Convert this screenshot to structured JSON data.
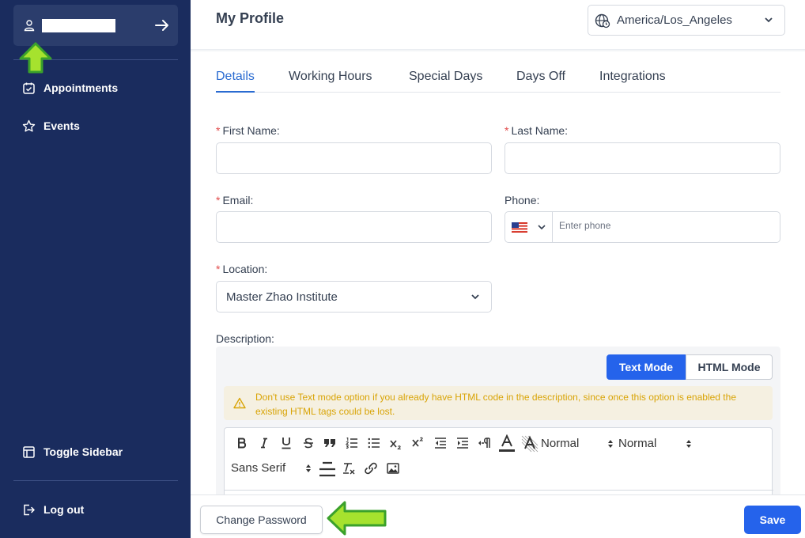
{
  "sidebar": {
    "items": [
      {
        "label": "Appointments",
        "icon": "calendar-check-icon"
      },
      {
        "label": "Events",
        "icon": "star-icon"
      }
    ],
    "toggle_label": "Toggle Sidebar",
    "logout_label": "Log out",
    "colors": {
      "background": "#1a2c5e",
      "card": "#2b3d6c"
    }
  },
  "header": {
    "title": "My Profile",
    "timezone": "America/Los_Angeles"
  },
  "tabs": [
    {
      "label": "Details",
      "active": true
    },
    {
      "label": "Working Hours",
      "active": false
    },
    {
      "label": "Special Days",
      "active": false
    },
    {
      "label": "Days Off",
      "active": false
    },
    {
      "label": "Integrations",
      "active": false
    }
  ],
  "form": {
    "first_name_label": "First Name:",
    "last_name_label": "Last Name:",
    "email_label": "Email:",
    "phone_label": "Phone:",
    "phone_placeholder": "Enter phone",
    "location_label": "Location:",
    "location_value": "Master Zhao Institute",
    "description_label": "Description:",
    "required_mark": "*"
  },
  "description": {
    "text_mode_label": "Text Mode",
    "html_mode_label": "HTML Mode",
    "warning_text": "Don't use Text mode option if you already have HTML code in the description, since once this option is enabled the existing HTML tags could be lost.",
    "toolbar": {
      "heading_value": "Normal",
      "size_value": "Normal",
      "font_value": "Sans Serif"
    }
  },
  "footer": {
    "change_password_label": "Change Password",
    "save_label": "Save"
  },
  "colors": {
    "primary": "#2563eb",
    "tab_active": "#2a6bd1",
    "required": "#e24c4c",
    "warning_text": "#d9a406",
    "annotation_arrow": "#a6e22e"
  }
}
